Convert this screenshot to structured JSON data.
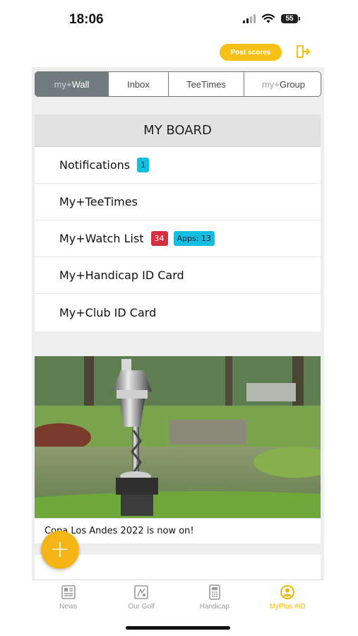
{
  "status_bar": {
    "time": "18:06",
    "battery": "55"
  },
  "top_actions": {
    "post_scores": "Post scores"
  },
  "tabs": [
    {
      "prefix": "my+",
      "label": "Wall",
      "active": true
    },
    {
      "prefix": "",
      "label": "Inbox",
      "active": false
    },
    {
      "prefix": "",
      "label": "TeeTimes",
      "active": false
    },
    {
      "prefix": "my+",
      "label": "Group",
      "active": false
    }
  ],
  "board": {
    "title": "MY BOARD",
    "items": [
      {
        "label": "Notifications",
        "badge": "1"
      },
      {
        "label": "My+TeeTimes"
      },
      {
        "label": "My+Watch List",
        "badge_count": "34",
        "badge_apps": "Apps: 13"
      },
      {
        "label": "My+Handicap ID Card"
      },
      {
        "label": "My+Club ID Card"
      }
    ]
  },
  "news": {
    "caption": "Copa Los Andes 2022 is now on!"
  },
  "fab_label": "+",
  "bottom_nav": [
    {
      "label": "News",
      "icon": "news-icon",
      "active": false
    },
    {
      "label": "Our Golf",
      "icon": "our-golf-icon",
      "active": false
    },
    {
      "label": "Handicap",
      "icon": "calculator-icon",
      "active": false
    },
    {
      "label": "MyPlus #ID",
      "icon": "profile-icon",
      "active": true
    }
  ],
  "colors": {
    "accent": "#f6c114",
    "tab_active": "#707b7d",
    "badge_cyan": "#13bfe0",
    "badge_red": "#d62f42"
  }
}
